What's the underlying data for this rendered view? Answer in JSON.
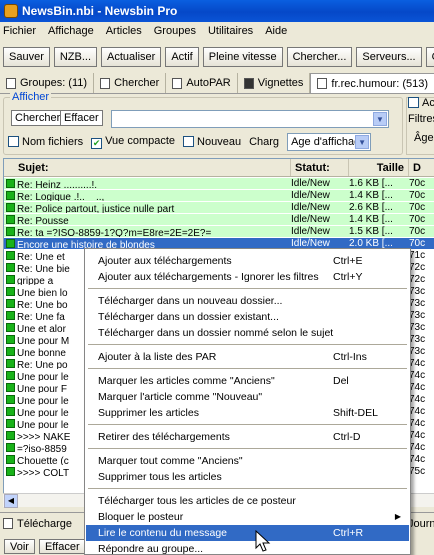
{
  "window": {
    "title": "NewsBin.nbi - Newsbin Pro"
  },
  "menu": [
    "Fichier",
    "Affichage",
    "Articles",
    "Groupes",
    "Utilitaires",
    "Aide"
  ],
  "toolbar": [
    "Sauver",
    "NZB...",
    "Actualiser",
    "Actif",
    "Pleine vitesse",
    "Chercher...",
    "Serveurs...",
    "G"
  ],
  "tabs": [
    {
      "label": "Groupes: (11)"
    },
    {
      "label": "Chercher"
    },
    {
      "label": "AutoPAR"
    },
    {
      "label": "Vignettes"
    },
    {
      "label": "fr.rec.humour: (513)"
    }
  ],
  "filter": {
    "title": "Afficher",
    "search_button": "Chercher",
    "clear_button": "Effacer",
    "search_value": "",
    "nom_fichiers": "Nom fichiers",
    "vue_compacte": "Vue compacte",
    "nouveau": "Nouveau",
    "charg": "Charg",
    "age_select": "Age d'affichage",
    "right_act": "Act",
    "right_filtres": "Filtres",
    "right_age": "Âge"
  },
  "list": {
    "headers": [
      "Sujet:",
      "Statut:",
      "Taille",
      "D"
    ],
    "rows": [
      {
        "subject": "Re: Heinz ..........!.",
        "status": "Idle/New",
        "size": "1.6 KB [...",
        "date": "70c",
        "style": "green"
      },
      {
        "subject": "Re: Logique .!.. _ ..,",
        "status": "Idle/New",
        "size": "1.4 KB [...",
        "date": "70c",
        "style": "green"
      },
      {
        "subject": "Re: Police partout, justice nulle part",
        "status": "Idle/New",
        "size": "2.6 KB [...",
        "date": "70c",
        "style": "green"
      },
      {
        "subject": "Re: Pousse",
        "status": "Idle/New",
        "size": "1.4 KB [...",
        "date": "70c",
        "style": "green"
      },
      {
        "subject": "Re: ta =?ISO-8859-1?Q?m=E8re=2E=2E?=",
        "status": "Idle/New",
        "size": "1.5 KB [...",
        "date": "70c",
        "style": "green"
      },
      {
        "subject": "Encore une histoire de blondes",
        "status": "Idle/New",
        "size": "2.0 KB [...",
        "date": "70c",
        "style": "selected"
      },
      {
        "subject": "Re: Une et",
        "status": "",
        "size": "",
        "date": "71c",
        "style": ""
      },
      {
        "subject": "Re: Une bie",
        "status": "",
        "size": "",
        "date": "72c",
        "style": ""
      },
      {
        "subject": "grippe a",
        "status": "",
        "size": "",
        "date": "72c",
        "style": ""
      },
      {
        "subject": "Une bien lo",
        "status": "",
        "size": "",
        "date": "73c",
        "style": ""
      },
      {
        "subject": "Re: Une bo",
        "status": "",
        "size": "",
        "date": "73c",
        "style": ""
      },
      {
        "subject": "Re: Une fa",
        "status": "",
        "size": "",
        "date": "73c",
        "style": ""
      },
      {
        "subject": "Une et alor",
        "status": "",
        "size": "",
        "date": "73c",
        "style": ""
      },
      {
        "subject": "Une pour M",
        "status": "",
        "size": "",
        "date": "73c",
        "style": ""
      },
      {
        "subject": "Une bonne",
        "status": "",
        "size": "",
        "date": "73c",
        "style": ""
      },
      {
        "subject": "Re: Une po",
        "status": "",
        "size": "",
        "date": "74c",
        "style": ""
      },
      {
        "subject": "Une pour le",
        "status": "",
        "size": "",
        "date": "74c",
        "style": ""
      },
      {
        "subject": "Une pour F",
        "status": "",
        "size": "",
        "date": "74c",
        "style": ""
      },
      {
        "subject": "Une pour le",
        "status": "",
        "size": "",
        "date": "74c",
        "style": ""
      },
      {
        "subject": "Une pour le",
        "status": "",
        "size": "",
        "date": "74c",
        "style": ""
      },
      {
        "subject": "Une pour le",
        "status": "",
        "size": "",
        "date": "74c",
        "style": ""
      },
      {
        "subject": ">>>> NAKE",
        "status": "",
        "size": "",
        "date": "74c",
        "style": ""
      },
      {
        "subject": "=?iso-8859",
        "status": "",
        "size": "",
        "date": "74c",
        "style": ""
      },
      {
        "subject": "Chouette (c",
        "status": "",
        "size": "",
        "date": "74c",
        "style": ""
      },
      {
        "subject": ">>>> COLT",
        "status": "",
        "size": "",
        "date": "75c",
        "style": ""
      }
    ]
  },
  "bottom": {
    "tab_label": "Télécharge",
    "right_label": "Journ",
    "voir": "Voir",
    "effacer": "Effacer"
  },
  "context_menu": [
    {
      "label": "Ajouter aux téléchargements",
      "shortcut": "Ctrl+E"
    },
    {
      "label": "Ajouter aux téléchargements - Ignorer les filtres",
      "shortcut": "Ctrl+Y"
    },
    {
      "sep": true
    },
    {
      "label": "Télécharger dans un nouveau dossier...",
      "shortcut": ""
    },
    {
      "label": "Télécharger dans un dossier existant...",
      "shortcut": ""
    },
    {
      "label": "Télécharger dans un dossier nommé selon le sujet",
      "shortcut": ""
    },
    {
      "sep": true
    },
    {
      "label": "Ajouter à la liste des PAR",
      "shortcut": "Ctrl-Ins"
    },
    {
      "sep": true
    },
    {
      "label": "Marquer les articles comme \"Anciens\"",
      "shortcut": "Del"
    },
    {
      "label": "Marquer l'article comme \"Nouveau\"",
      "shortcut": ""
    },
    {
      "label": "Supprimer les articles",
      "shortcut": "Shift-DEL"
    },
    {
      "sep": true
    },
    {
      "label": "Retirer des téléchargements",
      "shortcut": "Ctrl-D"
    },
    {
      "sep": true
    },
    {
      "label": "Marquer tout comme \"Anciens\"",
      "shortcut": ""
    },
    {
      "label": "Supprimer tous les articles",
      "shortcut": ""
    },
    {
      "sep": true
    },
    {
      "label": "Télécharger tous les articles de ce posteur",
      "shortcut": ""
    },
    {
      "label": "Bloquer le posteur",
      "shortcut": "",
      "submenu": true
    },
    {
      "label": "Lire le contenu du message",
      "shortcut": "Ctrl+R",
      "highlight": true
    },
    {
      "label": "Répondre au groupe...",
      "shortcut": ""
    }
  ],
  "colors": {
    "title": "#0A54D6",
    "selected": "#316AC5",
    "green_row": "#CCFFCC",
    "green_square": "#19B219"
  }
}
